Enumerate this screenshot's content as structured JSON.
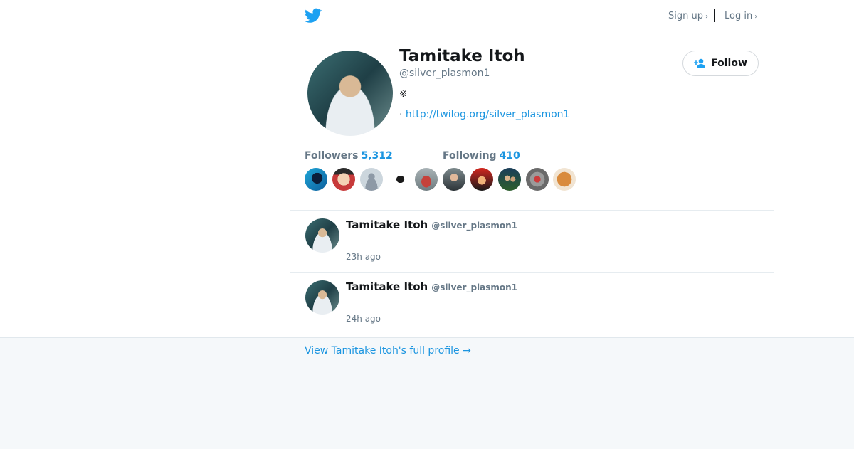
{
  "header": {
    "logo_icon": "twitter-bird-icon",
    "signup_label": "Sign up",
    "login_label": "Log in",
    "chevron": "›"
  },
  "profile": {
    "name": "Tamitake Itoh",
    "handle": "@silver_plasmon1",
    "bio": "※",
    "url_prefix": "·",
    "url": "http://twilog.org/silver_plasmon1",
    "follow_label": "Follow",
    "followers_label": "Followers",
    "followers_count": "5,312",
    "following_label": "Following",
    "following_count": "410"
  },
  "followers_avatars": [
    "blue-avatar",
    "face-avatar",
    "default-avatar",
    "bw-avatar"
  ],
  "following_avatars": [
    "train-avatar",
    "man-avatar",
    "anime-avatar",
    "crowd-avatar",
    "robot-avatar",
    "bread-avatar"
  ],
  "tweets": [
    {
      "name": "Tamitake Itoh",
      "handle": "@silver_plasmon1",
      "time": "23h ago"
    },
    {
      "name": "Tamitake Itoh",
      "handle": "@silver_plasmon1",
      "time": "24h ago"
    }
  ],
  "footer": {
    "full_profile_link": "View Tamitake Itoh's full profile →"
  },
  "colors": {
    "accent": "#1b95e0",
    "muted": "#657786",
    "footer_bg": "#f5f8fa"
  }
}
